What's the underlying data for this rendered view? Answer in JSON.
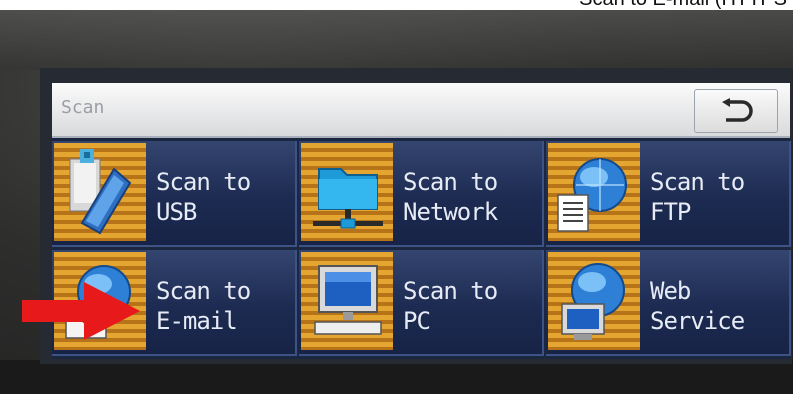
{
  "caption": "Scan to E-mail (HTTPS",
  "panel": {
    "title": "Scan",
    "back_icon": "return-arrow-icon",
    "tiles": [
      {
        "line1": "Scan to",
        "line2": "USB",
        "icon": "usb-drive-icon"
      },
      {
        "line1": "Scan to",
        "line2": "Network",
        "icon": "network-folder-icon"
      },
      {
        "line1": "Scan to",
        "line2": "FTP",
        "icon": "ftp-globe-icon"
      },
      {
        "line1": "Scan to",
        "line2": "E-mail",
        "icon": "email-globe-icon"
      },
      {
        "line1": "Scan to",
        "line2": "PC",
        "icon": "pc-monitor-icon"
      },
      {
        "line1": "Web",
        "line2": "Service",
        "icon": "web-service-globe-icon"
      }
    ]
  },
  "colors": {
    "arrow": "#e8191a",
    "tile_bg": "#1d2b52",
    "icon_bg": "#e4a531"
  }
}
